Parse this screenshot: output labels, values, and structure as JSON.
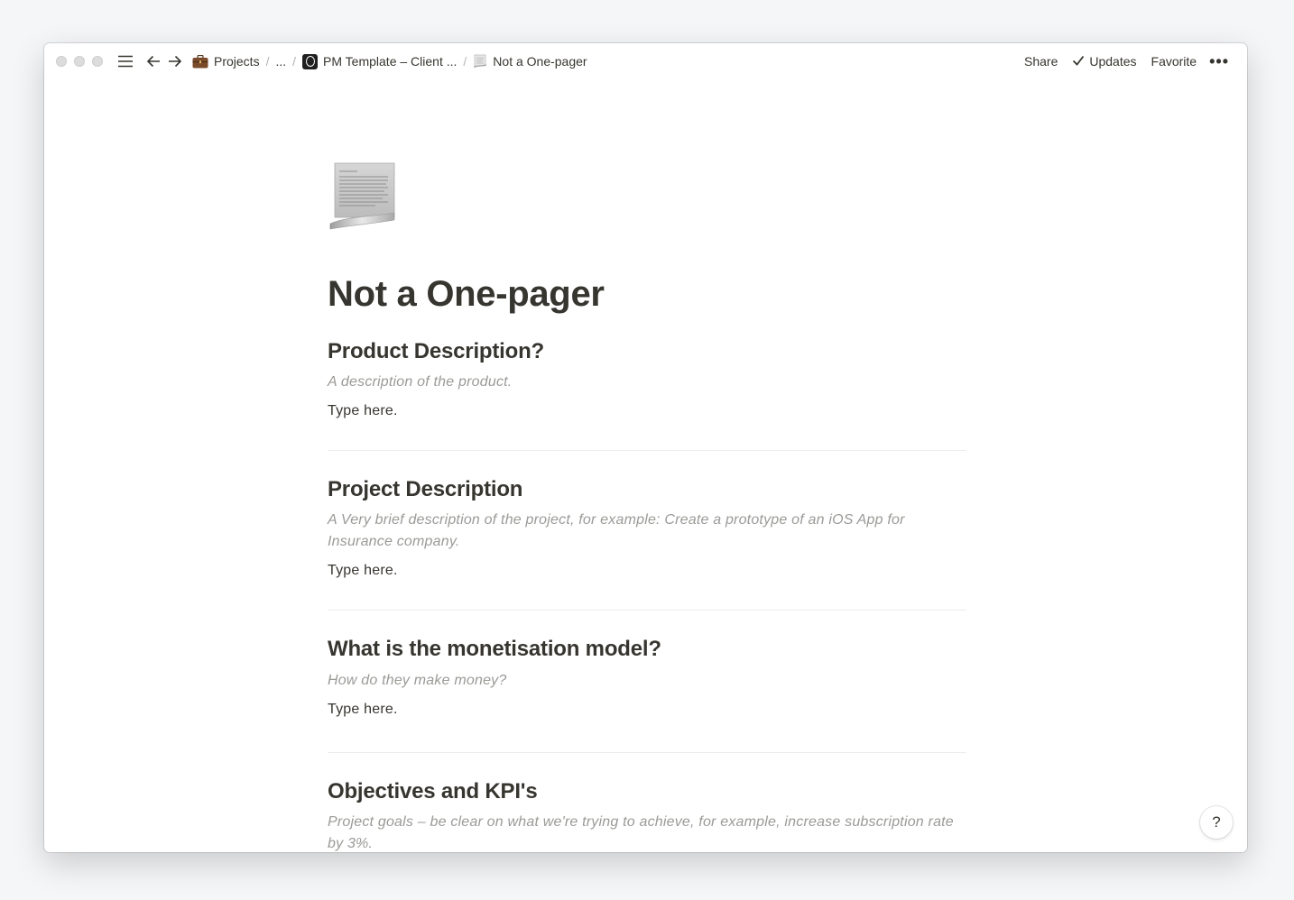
{
  "topbar": {
    "breadcrumbs": [
      {
        "label": "Projects",
        "icon": "briefcase-icon"
      },
      {
        "label": "..."
      },
      {
        "label": "PM Template – Client ...",
        "icon": "project-logo-icon"
      },
      {
        "label": "Not a One-pager",
        "icon": "scroll-page-icon"
      }
    ],
    "separator": "/",
    "share_label": "Share",
    "updates_label": "Updates",
    "favorite_label": "Favorite",
    "more_label": "•••"
  },
  "page": {
    "icon": "scroll-page-icon",
    "title": "Not a One-pager",
    "sections": [
      {
        "heading": "Product Description?",
        "hint": "A description of the product.",
        "body": "Type here."
      },
      {
        "heading": "Project Description",
        "hint": "A Very brief description of the project, for example: Create a prototype of an iOS App for Insurance company.",
        "body": "Type here."
      },
      {
        "heading": "What is the monetisation model?",
        "hint": "How do they make money?",
        "body": "Type here."
      },
      {
        "heading": "Objectives and KPI's",
        "hint": "Project goals – be clear on what we're trying to achieve, for example, increase subscription rate by 3%.",
        "body": ""
      }
    ]
  },
  "help_label": "?",
  "colors": {
    "text": "#37352f",
    "hint": "#9b9a97",
    "divider": "#ececeb",
    "background": "#f5f6f8"
  }
}
